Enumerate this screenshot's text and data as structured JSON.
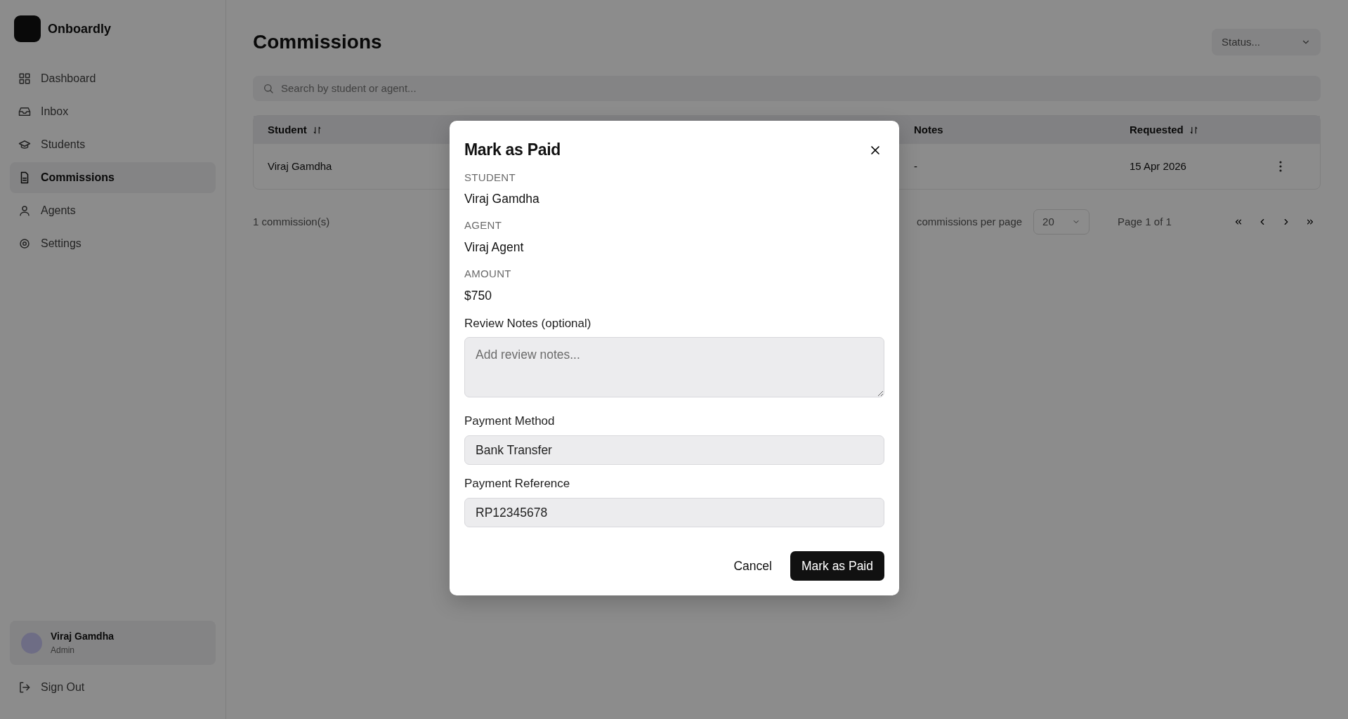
{
  "sidebar": {
    "brand": "Onboardly",
    "items": [
      {
        "label": "Dashboard",
        "selected": false
      },
      {
        "label": "Inbox",
        "selected": false
      },
      {
        "label": "Students",
        "selected": false
      },
      {
        "label": "Commissions",
        "selected": true
      },
      {
        "label": "Agents",
        "selected": false
      },
      {
        "label": "Settings",
        "selected": false
      }
    ],
    "user": {
      "name": "Viraj Gamdha",
      "role": "Admin"
    },
    "sign_out": "Sign Out"
  },
  "page": {
    "title": "Commissions",
    "status_filter": {
      "placeholder": "Status..."
    },
    "search": {
      "placeholder": "Search by student or agent..."
    },
    "table": {
      "columns": [
        {
          "label": "Student",
          "sortable": true
        },
        {
          "label": "Notes",
          "sortable": false
        },
        {
          "label": "Requested",
          "sortable": true
        }
      ],
      "rows": [
        {
          "cells": [
            "Viraj Gamdha",
            "-",
            "15 Apr 2026"
          ]
        }
      ]
    },
    "footer": {
      "count": "1 commission(s)",
      "per_page_label": "commissions per page",
      "per_page": "20",
      "page_info": "Page 1 of 1"
    }
  },
  "dialog": {
    "title": "Mark as Paid",
    "details": [
      {
        "label": "STUDENT",
        "value": "Viraj Gamdha"
      },
      {
        "label": "AGENT",
        "value": "Viraj Agent"
      },
      {
        "label": "AMOUNT",
        "value": "$750"
      }
    ],
    "fields": [
      {
        "kind": "textarea",
        "label": "Review Notes (optional)",
        "placeholder": "Add review notes..."
      },
      {
        "kind": "input",
        "label": "Payment Method",
        "value": "Bank Transfer"
      },
      {
        "kind": "input",
        "label": "Payment Reference",
        "value": "RP12345678"
      }
    ],
    "buttons": [
      {
        "label": "Cancel",
        "kind": "secondary"
      },
      {
        "label": "Mark as Paid",
        "kind": "primary"
      }
    ]
  }
}
